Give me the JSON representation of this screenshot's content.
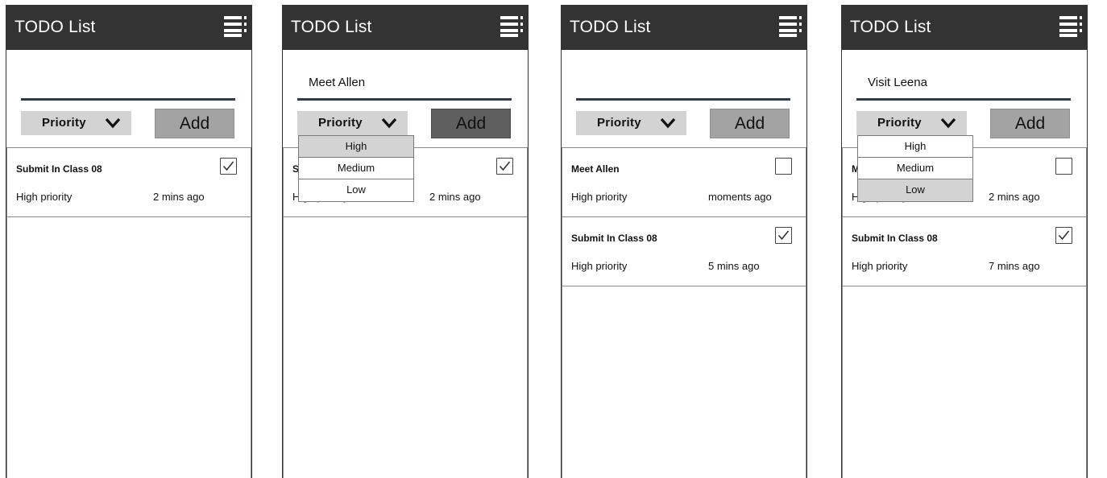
{
  "app": {
    "title": "TODO List"
  },
  "icons": {
    "menu": "menu-icon",
    "chevron": "chevron-down-icon",
    "checkbox": "checkbox-icon"
  },
  "colors": {
    "appbar": "#333333",
    "input_underline": "#2f3a4a",
    "select_bg": "#d3d3d3",
    "add_button": "#a3a3a3",
    "add_button_pressed": "#5f5f5f"
  },
  "screens": [
    {
      "input": {
        "value": ""
      },
      "priority_select": {
        "label": "Priority",
        "open": false
      },
      "add_button": {
        "label": "Add",
        "pressed": false
      },
      "tasks": [
        {
          "name": "Submit In Class 08",
          "priority": "High priority",
          "time": "2 mins ago",
          "checked": true
        }
      ]
    },
    {
      "input": {
        "value": "Meet Allen"
      },
      "priority_select": {
        "label": "Priority",
        "open": true,
        "options": [
          {
            "label": "High",
            "highlighted": true
          },
          {
            "label": "Medium",
            "highlighted": false
          },
          {
            "label": "Low",
            "highlighted": false
          }
        ]
      },
      "add_button": {
        "label": "Add",
        "pressed": true
      },
      "tasks": [
        {
          "name": "Submit In Class 08",
          "priority": "High priority",
          "time": "2 mins ago",
          "checked": true
        }
      ]
    },
    {
      "input": {
        "value": ""
      },
      "priority_select": {
        "label": "Priority",
        "open": false
      },
      "add_button": {
        "label": "Add",
        "pressed": false
      },
      "tasks": [
        {
          "name": "Meet Allen",
          "priority": "High priority",
          "time": "moments ago",
          "checked": false
        },
        {
          "name": "Submit In Class 08",
          "priority": "High priority",
          "time": "5 mins ago",
          "checked": true
        }
      ]
    },
    {
      "input": {
        "value": "Visit Leena"
      },
      "priority_select": {
        "label": "Priority",
        "open": true,
        "options": [
          {
            "label": "High",
            "highlighted": false
          },
          {
            "label": "Medium",
            "highlighted": false
          },
          {
            "label": "Low",
            "highlighted": true
          }
        ]
      },
      "add_button": {
        "label": "Add",
        "pressed": false
      },
      "tasks": [
        {
          "name": "Meet Allen",
          "priority": "High priority",
          "time": "2 mins ago",
          "checked": false
        },
        {
          "name": "Submit In Class 08",
          "priority": "High priority",
          "time": "7 mins ago",
          "checked": true
        }
      ]
    }
  ]
}
